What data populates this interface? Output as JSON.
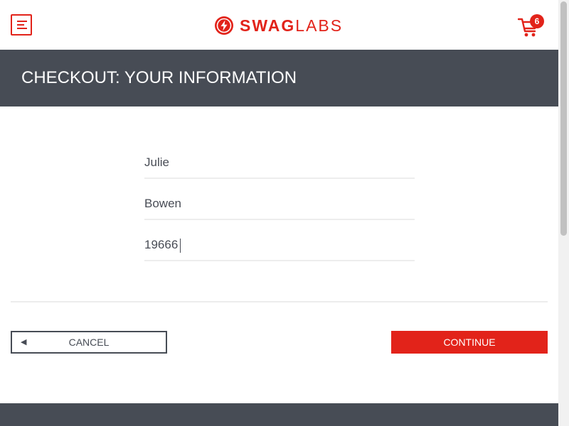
{
  "header": {
    "menu_icon": "hamburger-menu-icon",
    "logo": {
      "icon": "swag-labs-bolt-icon",
      "text_bold": "SWAG",
      "text_light": "LABS",
      "color": "#e2231a"
    },
    "cart": {
      "icon": "shopping-cart-icon",
      "badge_count": "6"
    }
  },
  "title_bar": {
    "title": "CHECKOUT: YOUR INFORMATION",
    "background": "#474c55"
  },
  "form": {
    "first_name": "Julie",
    "last_name": "Bowen",
    "postal_code": "19666"
  },
  "actions": {
    "cancel_label": "CANCEL",
    "cancel_icon": "back-arrow-icon",
    "continue_label": "CONTINUE",
    "accent": "#e2231a"
  }
}
